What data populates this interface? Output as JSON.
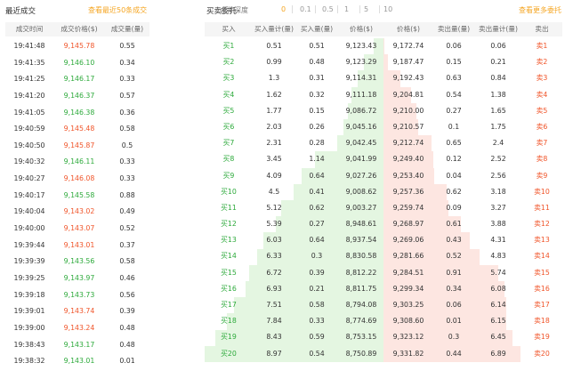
{
  "trades": {
    "title": "最近成交",
    "more_link": "查看最近50条成交",
    "columns": [
      "成交时间",
      "成交价格($)",
      "成交量(量)"
    ],
    "rows": [
      {
        "time": "19:41:48",
        "price": "9,145.78",
        "vol": "0.55",
        "dir": "down"
      },
      {
        "time": "19:41:35",
        "price": "9,146.10",
        "vol": "0.34",
        "dir": "up"
      },
      {
        "time": "19:41:25",
        "price": "9,146.17",
        "vol": "0.33",
        "dir": "up"
      },
      {
        "time": "19:41:20",
        "price": "9,146.37",
        "vol": "0.57",
        "dir": "up"
      },
      {
        "time": "19:41:05",
        "price": "9,146.38",
        "vol": "0.36",
        "dir": "up"
      },
      {
        "time": "19:40:59",
        "price": "9,145.48",
        "vol": "0.58",
        "dir": "down"
      },
      {
        "time": "19:40:50",
        "price": "9,145.87",
        "vol": "0.5",
        "dir": "down"
      },
      {
        "time": "19:40:32",
        "price": "9,146.11",
        "vol": "0.33",
        "dir": "up"
      },
      {
        "time": "19:40:27",
        "price": "9,146.08",
        "vol": "0.33",
        "dir": "down"
      },
      {
        "time": "19:40:17",
        "price": "9,145.58",
        "vol": "0.88",
        "dir": "up"
      },
      {
        "time": "19:40:04",
        "price": "9,143.02",
        "vol": "0.49",
        "dir": "down"
      },
      {
        "time": "19:40:00",
        "price": "9,143.07",
        "vol": "0.52",
        "dir": "down"
      },
      {
        "time": "19:39:44",
        "price": "9,143.01",
        "vol": "0.37",
        "dir": "down"
      },
      {
        "time": "19:39:39",
        "price": "9,143.56",
        "vol": "0.58",
        "dir": "up"
      },
      {
        "time": "19:39:25",
        "price": "9,143.97",
        "vol": "0.46",
        "dir": "up"
      },
      {
        "time": "19:39:18",
        "price": "9,143.73",
        "vol": "0.56",
        "dir": "up"
      },
      {
        "time": "19:39:01",
        "price": "9,143.74",
        "vol": "0.39",
        "dir": "down"
      },
      {
        "time": "19:39:00",
        "price": "9,143.24",
        "vol": "0.48",
        "dir": "down"
      },
      {
        "time": "19:38:43",
        "price": "9,143.17",
        "vol": "0.48",
        "dir": "up"
      },
      {
        "time": "19:38:32",
        "price": "9,143.01",
        "vol": "0.01",
        "dir": "up"
      }
    ]
  },
  "orderbook": {
    "title": "买卖委托",
    "merge_label": "合并深度",
    "merge_options": [
      "0",
      "0.1",
      "0.5",
      "1",
      "5",
      "10"
    ],
    "merge_active": "0",
    "more_link": "查看更多委托",
    "columns": [
      "买入",
      "买入量计(量)",
      "买入量(量)",
      "价格($)",
      "价格($)",
      "卖出量(量)",
      "卖出量计(量)",
      "卖出"
    ],
    "rows": [
      {
        "buy": "买1",
        "buy_cum": "0.51",
        "buy_vol": "0.51",
        "bid": "9,123.43",
        "ask": "9,172.74",
        "sell_vol": "0.06",
        "sell_cum": "0.06",
        "sell": "卖1"
      },
      {
        "buy": "买2",
        "buy_cum": "0.99",
        "buy_vol": "0.48",
        "bid": "9,123.29",
        "ask": "9,187.47",
        "sell_vol": "0.15",
        "sell_cum": "0.21",
        "sell": "卖2"
      },
      {
        "buy": "买3",
        "buy_cum": "1.3",
        "buy_vol": "0.31",
        "bid": "9,114.31",
        "ask": "9,192.43",
        "sell_vol": "0.63",
        "sell_cum": "0.84",
        "sell": "卖3"
      },
      {
        "buy": "买4",
        "buy_cum": "1.62",
        "buy_vol": "0.32",
        "bid": "9,111.18",
        "ask": "9,204.81",
        "sell_vol": "0.54",
        "sell_cum": "1.38",
        "sell": "卖4"
      },
      {
        "buy": "买5",
        "buy_cum": "1.77",
        "buy_vol": "0.15",
        "bid": "9,086.72",
        "ask": "9,210.00",
        "sell_vol": "0.27",
        "sell_cum": "1.65",
        "sell": "卖5"
      },
      {
        "buy": "买6",
        "buy_cum": "2.03",
        "buy_vol": "0.26",
        "bid": "9,045.16",
        "ask": "9,210.57",
        "sell_vol": "0.1",
        "sell_cum": "1.75",
        "sell": "卖6"
      },
      {
        "buy": "买7",
        "buy_cum": "2.31",
        "buy_vol": "0.28",
        "bid": "9,042.45",
        "ask": "9,212.74",
        "sell_vol": "0.65",
        "sell_cum": "2.4",
        "sell": "卖7"
      },
      {
        "buy": "买8",
        "buy_cum": "3.45",
        "buy_vol": "1.14",
        "bid": "9,041.99",
        "ask": "9,249.40",
        "sell_vol": "0.12",
        "sell_cum": "2.52",
        "sell": "卖8"
      },
      {
        "buy": "买9",
        "buy_cum": "4.09",
        "buy_vol": "0.64",
        "bid": "9,027.26",
        "ask": "9,253.40",
        "sell_vol": "0.04",
        "sell_cum": "2.56",
        "sell": "卖9"
      },
      {
        "buy": "买10",
        "buy_cum": "4.5",
        "buy_vol": "0.41",
        "bid": "9,008.62",
        "ask": "9,257.36",
        "sell_vol": "0.62",
        "sell_cum": "3.18",
        "sell": "卖10"
      },
      {
        "buy": "买11",
        "buy_cum": "5.12",
        "buy_vol": "0.62",
        "bid": "9,003.27",
        "ask": "9,259.74",
        "sell_vol": "0.09",
        "sell_cum": "3.27",
        "sell": "卖11"
      },
      {
        "buy": "买12",
        "buy_cum": "5.39",
        "buy_vol": "0.27",
        "bid": "8,948.61",
        "ask": "9,268.97",
        "sell_vol": "0.61",
        "sell_cum": "3.88",
        "sell": "卖12"
      },
      {
        "buy": "买13",
        "buy_cum": "6.03",
        "buy_vol": "0.64",
        "bid": "8,937.54",
        "ask": "9,269.06",
        "sell_vol": "0.43",
        "sell_cum": "4.31",
        "sell": "卖13"
      },
      {
        "buy": "买14",
        "buy_cum": "6.33",
        "buy_vol": "0.3",
        "bid": "8,830.58",
        "ask": "9,281.66",
        "sell_vol": "0.52",
        "sell_cum": "4.83",
        "sell": "卖14"
      },
      {
        "buy": "买15",
        "buy_cum": "6.72",
        "buy_vol": "0.39",
        "bid": "8,812.22",
        "ask": "9,284.51",
        "sell_vol": "0.91",
        "sell_cum": "5.74",
        "sell": "卖15"
      },
      {
        "buy": "买16",
        "buy_cum": "6.93",
        "buy_vol": "0.21",
        "bid": "8,811.75",
        "ask": "9,299.34",
        "sell_vol": "0.34",
        "sell_cum": "6.08",
        "sell": "卖16"
      },
      {
        "buy": "买17",
        "buy_cum": "7.51",
        "buy_vol": "0.58",
        "bid": "8,794.08",
        "ask": "9,303.25",
        "sell_vol": "0.06",
        "sell_cum": "6.14",
        "sell": "卖17"
      },
      {
        "buy": "买18",
        "buy_cum": "7.84",
        "buy_vol": "0.33",
        "bid": "8,774.69",
        "ask": "9,308.60",
        "sell_vol": "0.01",
        "sell_cum": "6.15",
        "sell": "卖18"
      },
      {
        "buy": "买19",
        "buy_cum": "8.43",
        "buy_vol": "0.59",
        "bid": "8,753.15",
        "ask": "9,323.12",
        "sell_vol": "0.3",
        "sell_cum": "6.45",
        "sell": "卖19"
      },
      {
        "buy": "买20",
        "buy_cum": "8.97",
        "buy_vol": "0.54",
        "bid": "8,750.89",
        "ask": "9,331.82",
        "sell_vol": "0.44",
        "sell_cum": "6.89",
        "sell": "卖20"
      }
    ]
  },
  "colors": {
    "up": "#2eaa3c",
    "down": "#f0552a",
    "accent": "#f5a623",
    "bid_depth": "#e4f6e1",
    "ask_depth": "#fde6e1",
    "header_bg": "#f5f5f5"
  }
}
